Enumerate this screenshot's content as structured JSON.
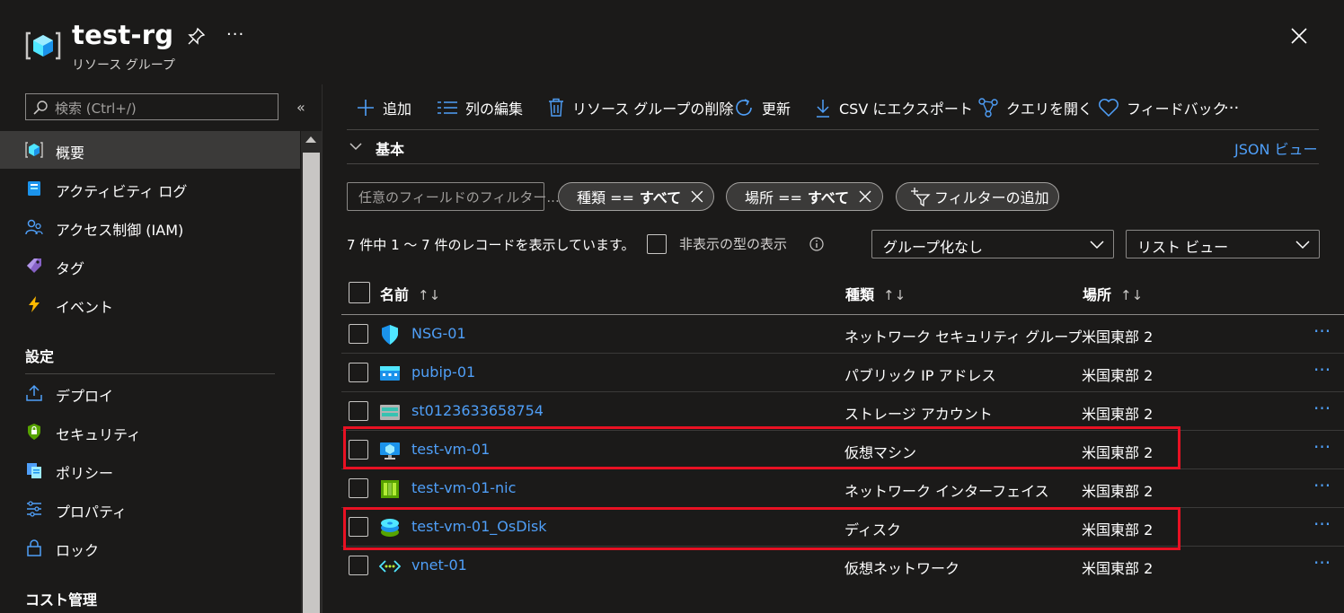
{
  "header": {
    "title": "test-rg",
    "subtitle": "リソース グループ",
    "more": "···"
  },
  "sidebar": {
    "search_placeholder": "検索 (Ctrl+/)",
    "collapse": "«",
    "items": [
      {
        "label": "概要",
        "icon": "resource-group-icon"
      },
      {
        "label": "アクティビティ ログ",
        "icon": "activity-log-icon"
      },
      {
        "label": "アクセス制御 (IAM)",
        "icon": "iam-icon"
      },
      {
        "label": "タグ",
        "icon": "tag-icon"
      },
      {
        "label": "イベント",
        "icon": "lightning-icon"
      }
    ],
    "section_settings": "設定",
    "settings_items": [
      {
        "label": "デプロイ",
        "icon": "deploy-icon"
      },
      {
        "label": "セキュリティ",
        "icon": "security-icon"
      },
      {
        "label": "ポリシー",
        "icon": "policy-icon"
      },
      {
        "label": "プロパティ",
        "icon": "properties-icon"
      },
      {
        "label": "ロック",
        "icon": "lock-icon"
      }
    ],
    "section_cost": "コスト管理"
  },
  "toolbar": {
    "add": "追加",
    "edit_columns": "列の編集",
    "delete_rg": "リソース グループの削除",
    "refresh": "更新",
    "export_csv": "CSV にエクスポート",
    "open_query": "クエリを開く",
    "feedback": "フィードバック",
    "more": "···"
  },
  "essentials": {
    "label": "基本",
    "json_view": "JSON ビュー"
  },
  "filters": {
    "field_placeholder": "任意のフィールドのフィルター...",
    "type_key": "種類 ==",
    "type_value": "すべて",
    "location_key": "場所 ==",
    "location_value": "すべて",
    "add_filter": "フィルターの追加"
  },
  "records": {
    "count_text": "7 件中 1 ～ 7 件のレコードを表示しています。",
    "show_hidden": "非表示の型の表示",
    "grouping": "グループ化なし",
    "view": "リスト ビュー"
  },
  "table": {
    "headers": {
      "name": "名前",
      "type": "種類",
      "location": "場所",
      "sort": "↑↓"
    },
    "rows": [
      {
        "name": "NSG-01",
        "type": "ネットワーク セキュリティ グループ",
        "location": "米国東部 2",
        "icon": "nsg-icon"
      },
      {
        "name": "pubip-01",
        "type": "パブリック IP アドレス",
        "location": "米国東部 2",
        "icon": "public-ip-icon"
      },
      {
        "name": "st0123633658754",
        "type": "ストレージ アカウント",
        "location": "米国東部 2",
        "icon": "storage-icon"
      },
      {
        "name": "test-vm-01",
        "type": "仮想マシン",
        "location": "米国東部 2",
        "icon": "vm-icon"
      },
      {
        "name": "test-vm-01-nic",
        "type": "ネットワーク インターフェイス",
        "location": "米国東部 2",
        "icon": "nic-icon"
      },
      {
        "name": "test-vm-01_OsDisk",
        "type": "ディスク",
        "location": "米国東部 2",
        "icon": "disk-icon"
      },
      {
        "name": "vnet-01",
        "type": "仮想ネットワーク",
        "location": "米国東部 2",
        "icon": "vnet-icon"
      }
    ],
    "row_more": "···"
  },
  "colors": {
    "background": "#1b1a19",
    "link": "#4f9ff8",
    "highlight": "#e81123",
    "nav_active": "#3b3a39"
  }
}
